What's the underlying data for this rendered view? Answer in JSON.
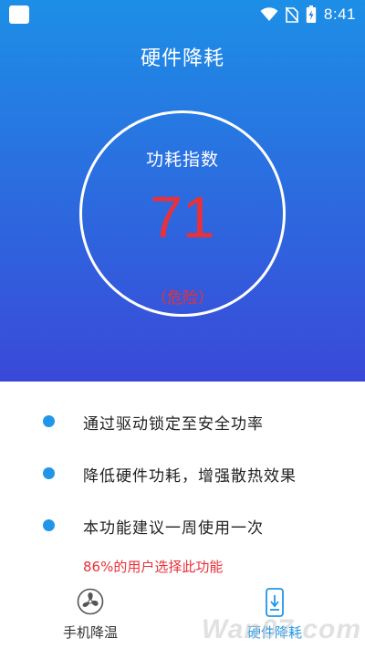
{
  "status_bar": {
    "time": "8:41",
    "icons": [
      "app-square-icon",
      "wifi-icon",
      "no-sim-icon",
      "battery-charging-icon"
    ]
  },
  "header": {
    "title": "硬件降耗"
  },
  "gauge": {
    "label": "功耗指数",
    "value": "71",
    "status": "（危险）",
    "level": 71
  },
  "features": [
    {
      "text": "通过驱动锁定至安全功率"
    },
    {
      "text": "降低硬件功耗，增强散热效果"
    },
    {
      "text": "本功能建议一周使用一次"
    }
  ],
  "user_note": "86%的用户选择此功能",
  "bottom_nav": {
    "items": [
      {
        "label": "手机降温",
        "icon": "fan-icon",
        "active": false
      },
      {
        "label": "硬件降耗",
        "icon": "phone-download-icon",
        "active": true
      }
    ]
  },
  "watermark": "Wan07.com",
  "colors": {
    "accent_blue": "#2196e8",
    "danger_red": "#e8313a",
    "gradient_top": "#1d8fe6",
    "gradient_bottom": "#3a49d8"
  }
}
